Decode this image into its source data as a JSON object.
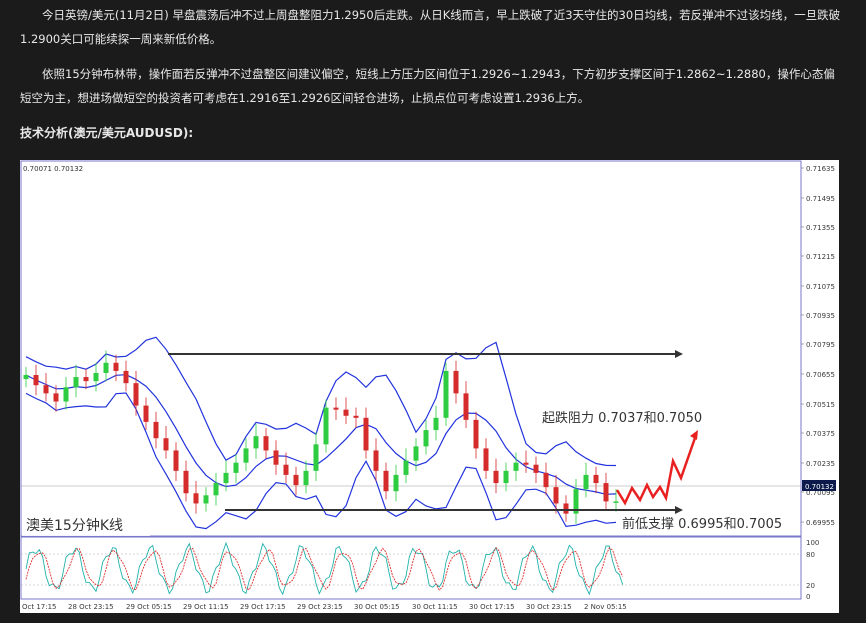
{
  "paragraphs": {
    "p1": "今日英镑/美元(11月2日) 早盘震荡后冲不过上周盘整阻力1.2950后走跌。从日K线而言，早上跌破了近3天守住的30日均线，若反弹冲不过该均线，一旦跌破1.2900关口可能续探一周来新低价格。",
    "p2": "依照15分钟布林带，操作面若反弹冲不过盘整区间建议偏空，短线上方压力区间位于1.2926~1.2943，下方初步支撑区间于1.2862~1.2880，操作心态偏短空为主，想进场做短空的投资者可考虑在1.2916至1.2926区间轻仓进场，止损点位可考虑设置1.2936上方。"
  },
  "heading": "技术分析(澳元/美元AUDUSD):",
  "chart": {
    "ohlc_label": "0.70071 0.70132",
    "price_labels": [
      "0.71635",
      "0.71495",
      "0.71355",
      "0.71215",
      "0.71075",
      "0.70935",
      "0.70795",
      "0.70655",
      "0.70515",
      "0.70375",
      "0.70235",
      "0.70095",
      "0.69955"
    ],
    "current_price": "0.70132",
    "osc_labels": [
      "100",
      "80",
      "20",
      "0"
    ],
    "time_labels": [
      "Oct 17:15",
      "28 Oct 23:15",
      "29 Oct 05:15",
      "29 Oct 11:15",
      "29 Oct 17:15",
      "29 Oct 23:15",
      "30 Oct 05:15",
      "30 Oct 11:15",
      "30 Oct 17:15",
      "30 Oct 23:15",
      "2 Nov 05:15"
    ],
    "annotation_resistance": "起跌阻力 0.7037和0.7050",
    "annotation_support": "前低支撑 0.6995和0.7005",
    "annotation_title": "澳美15分钟K线",
    "colors": {
      "bull": "#2ecc40",
      "bear": "#d62b2b",
      "band": "#2233dd",
      "arrow": "#e82020"
    }
  },
  "chart_data": {
    "type": "line",
    "title": "澳美15分钟K线",
    "ylim": [
      0.699,
      0.717
    ],
    "series": [
      {
        "name": "",
        "values": [
          0.7067,
          0.7062,
          0.7058,
          0.7054,
          0.7061,
          0.7066,
          0.7064,
          0.7068,
          0.7073,
          0.7069,
          0.7063,
          0.7052,
          0.7044,
          0.7036,
          0.703,
          0.702,
          0.7009,
          0.7004,
          0.7008,
          0.7014,
          0.7019,
          0.7024,
          0.7031,
          0.7037,
          0.703,
          0.7023,
          0.7018,
          0.7013,
          0.702,
          0.7033,
          0.7051,
          0.705,
          0.7047,
          0.7046,
          0.703,
          0.702,
          0.701,
          0.7018,
          0.7025,
          0.7032,
          0.704,
          0.7046,
          0.7069,
          0.7058,
          0.7045,
          0.7031,
          0.702,
          0.7014,
          0.702,
          0.7024,
          0.7023,
          0.7019,
          0.7012,
          0.7004,
          0.6999,
          0.7011,
          0.7018,
          0.7014,
          0.7005,
          0.7005
        ]
      }
    ]
  }
}
